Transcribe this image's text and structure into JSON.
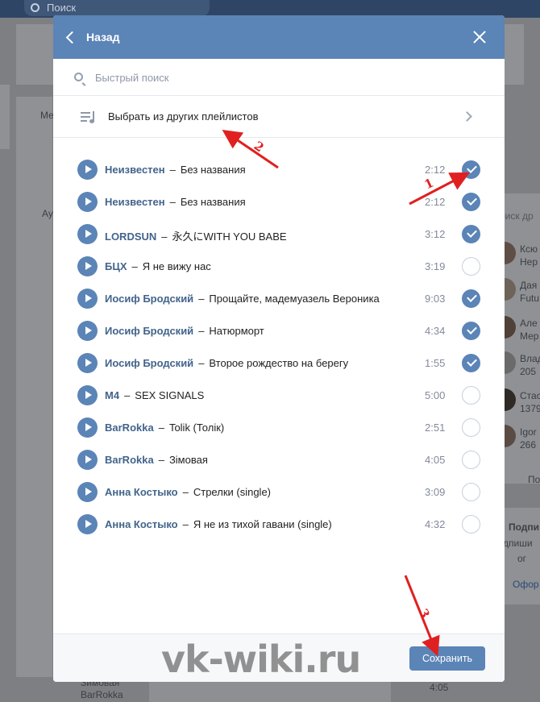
{
  "background": {
    "topbar_search_placeholder": "Поиск",
    "bg_texts": [
      "Ме",
      "Ау",
      "Подпи",
      "дпиши",
      "ог",
      "Офор",
      "Ксю",
      "Нер",
      "Дая",
      "Futu",
      "Але",
      "Мер",
      "Влад",
      "205",
      "Стас",
      "1379",
      "Igor",
      "266",
      "Пок",
      "оиск др",
      "Зимовая",
      "BarRokka",
      "4:05"
    ]
  },
  "modal": {
    "back_label": "Назад",
    "search_placeholder": "Быстрый поиск",
    "choose_playlists_label": "Выбрать из других плейлистов",
    "save_label": "Сохранить"
  },
  "tracks": [
    {
      "artist": "Неизвестен",
      "title": "Без названия",
      "duration": "2:12",
      "checked": true
    },
    {
      "artist": "Неизвестен",
      "title": "Без названия",
      "duration": "2:12",
      "checked": true
    },
    {
      "artist": "LORDSUN",
      "title": "永久にWITH YOU BABE",
      "duration": "3:12",
      "checked": true
    },
    {
      "artist": "БЦХ",
      "title": "Я не вижу нас",
      "duration": "3:19",
      "checked": false
    },
    {
      "artist": "Иосиф Бродский",
      "title": "Прощайте, мадемуазель Вероника",
      "duration": "9:03",
      "checked": true
    },
    {
      "artist": "Иосиф Бродский",
      "title": "Натюрморт",
      "duration": "4:34",
      "checked": true
    },
    {
      "artist": "Иосиф Бродский",
      "title": "Второе рождество на берегу",
      "duration": "1:55",
      "checked": true
    },
    {
      "artist": "M4",
      "title": "SEX SIGNALS",
      "duration": "5:00",
      "checked": false
    },
    {
      "artist": "BarRokka",
      "title": "Tolik (Толік)",
      "duration": "2:51",
      "checked": false
    },
    {
      "artist": "BarRokka",
      "title": "Зімовая",
      "duration": "4:05",
      "checked": false
    },
    {
      "artist": "Анна Костыко",
      "title": "Стрелки (single)",
      "duration": "3:09",
      "checked": false
    },
    {
      "artist": "Анна Костыко",
      "title": "Я не из тихой гавани (single)",
      "duration": "4:32",
      "checked": false
    }
  ],
  "annotations": {
    "one": "1",
    "two": "2",
    "three": "3",
    "color": "#e02020"
  },
  "watermark": "vk-wiki.ru",
  "colors": {
    "accent": "#5b84b7",
    "link": "#42648b"
  }
}
